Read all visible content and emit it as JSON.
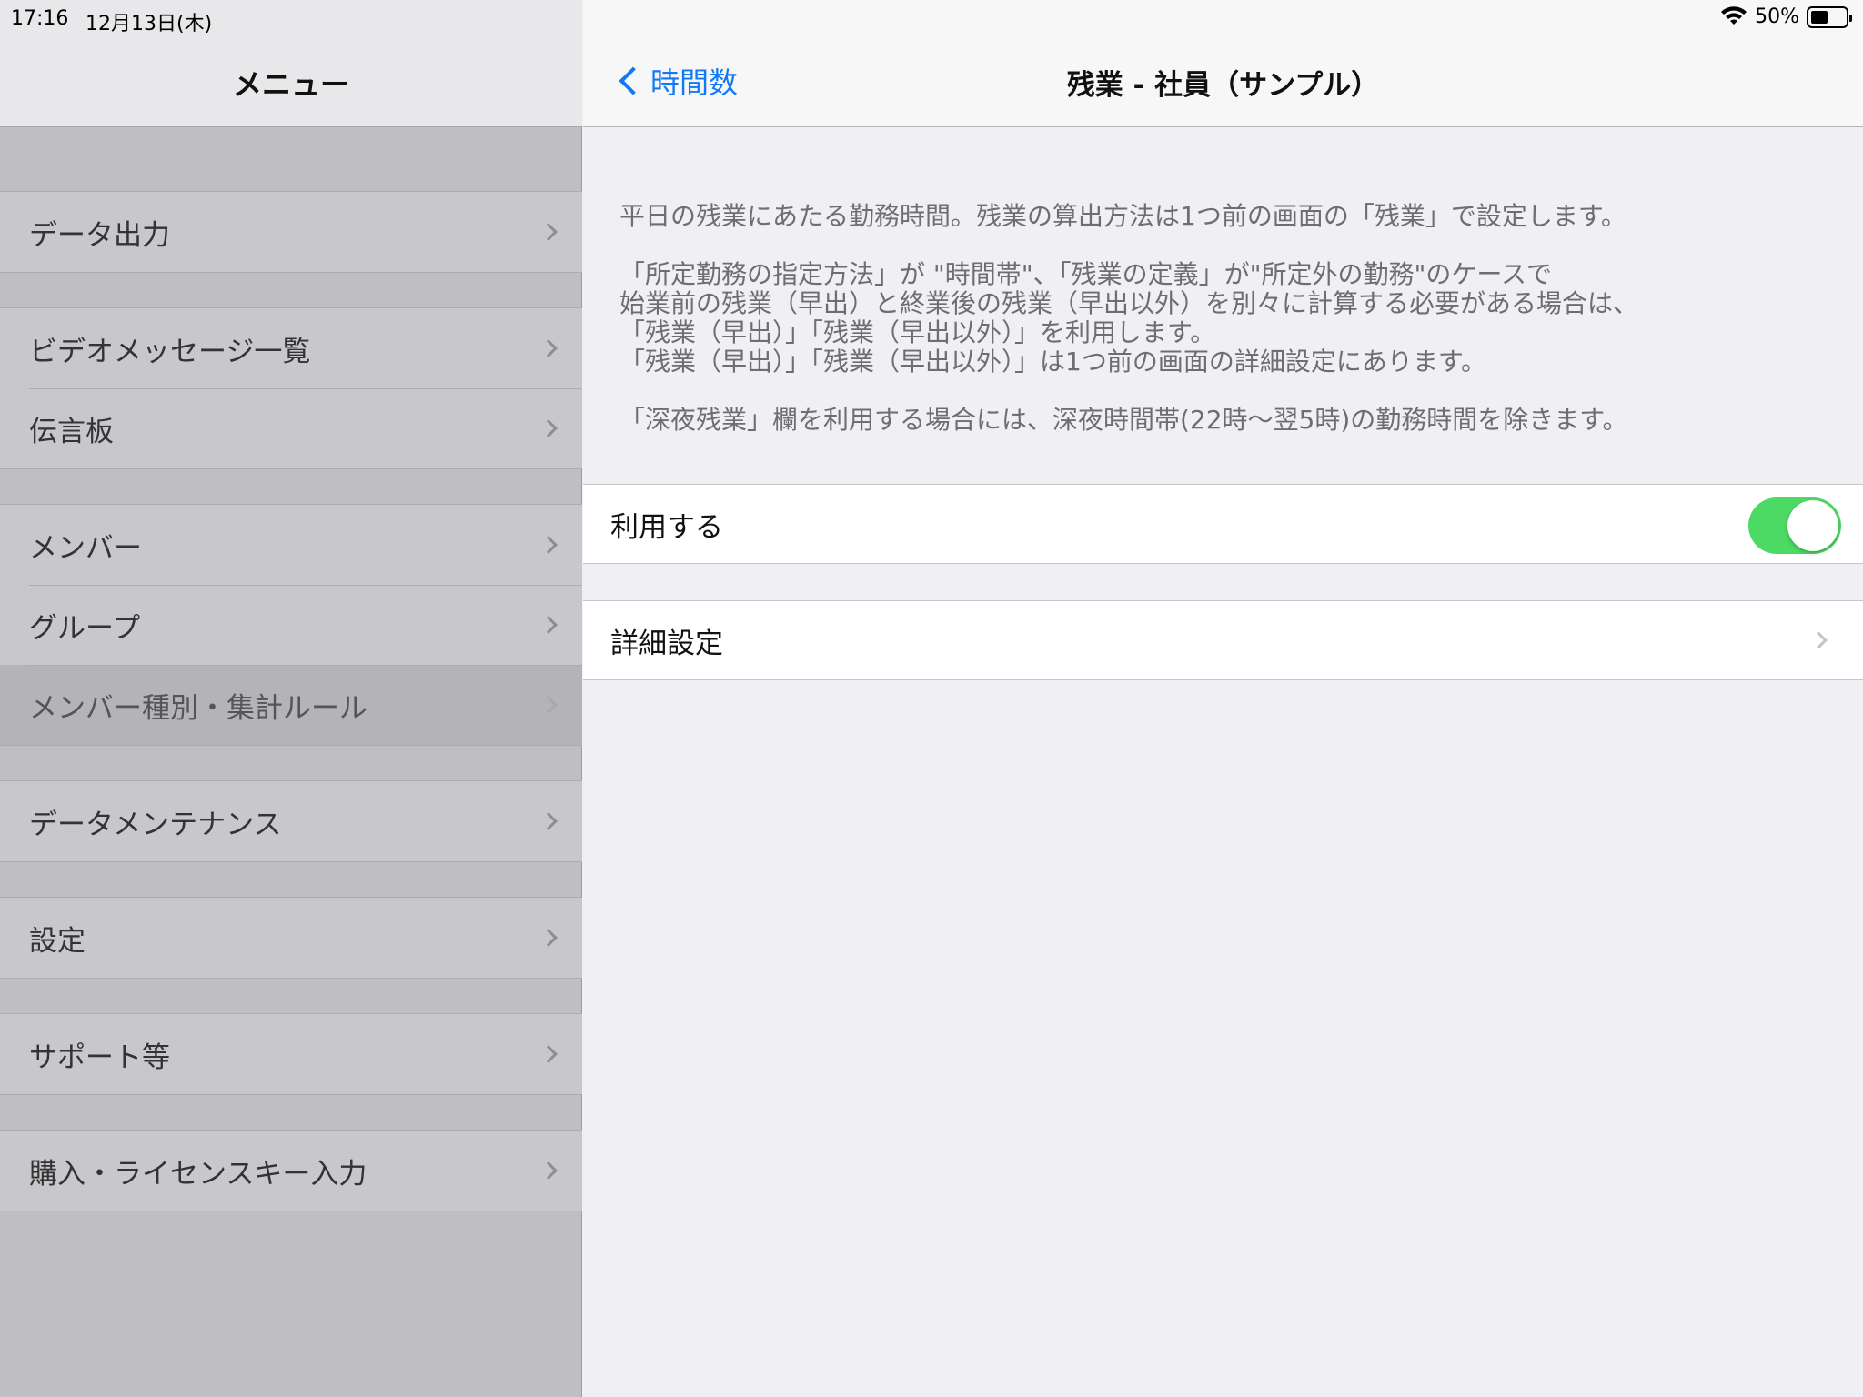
{
  "status_bar": {
    "time": "17:16",
    "date": "12月13日(木)",
    "battery_percent": "50%",
    "battery_level": 0.5
  },
  "sidebar": {
    "title": "メニュー",
    "groups": [
      {
        "items": [
          {
            "label": "データ出力"
          }
        ]
      },
      {
        "items": [
          {
            "label": "ビデオメッセージ一覧"
          },
          {
            "label": "伝言板"
          }
        ]
      },
      {
        "items": [
          {
            "label": "メンバー"
          },
          {
            "label": "グループ"
          },
          {
            "label": "メンバー種別・集計ルール",
            "selected": true
          }
        ]
      },
      {
        "items": [
          {
            "label": "データメンテナンス"
          }
        ]
      },
      {
        "items": [
          {
            "label": "設定"
          }
        ]
      },
      {
        "items": [
          {
            "label": "サポート等"
          }
        ]
      },
      {
        "items": [
          {
            "label": "購入・ライセンスキー入力"
          }
        ]
      }
    ]
  },
  "detail": {
    "back_label": "時間数",
    "title": "残業 - 社員（サンプル）",
    "description": {
      "p1": "平日の残業にあたる勤務時間。残業の算出方法は1つ前の画面の「残業」で設定します。",
      "p2_lines": [
        "「所定勤務の指定方法」が \"時間帯\"、「残業の定義」が\"所定外の勤務\"のケースで",
        "始業前の残業（早出）と終業後の残業（早出以外）を別々に計算する必要がある場合は、",
        "「残業（早出）」「残業（早出以外）」を利用します。",
        "「残業（早出）」「残業（早出以外）」は1つ前の画面の詳細設定にあります。"
      ],
      "p3": "「深夜残業」欄を利用する場合には、深夜時間帯(22時〜翌5時)の勤務時間を除きます。"
    },
    "use_toggle": {
      "label": "利用する",
      "on": true
    },
    "advanced": {
      "label": "詳細設定"
    }
  },
  "colors": {
    "accent": "#1279f6",
    "toggle_on": "#4cd964",
    "sidebar_bg": "#bebec3",
    "detail_bg": "#efeff4"
  }
}
